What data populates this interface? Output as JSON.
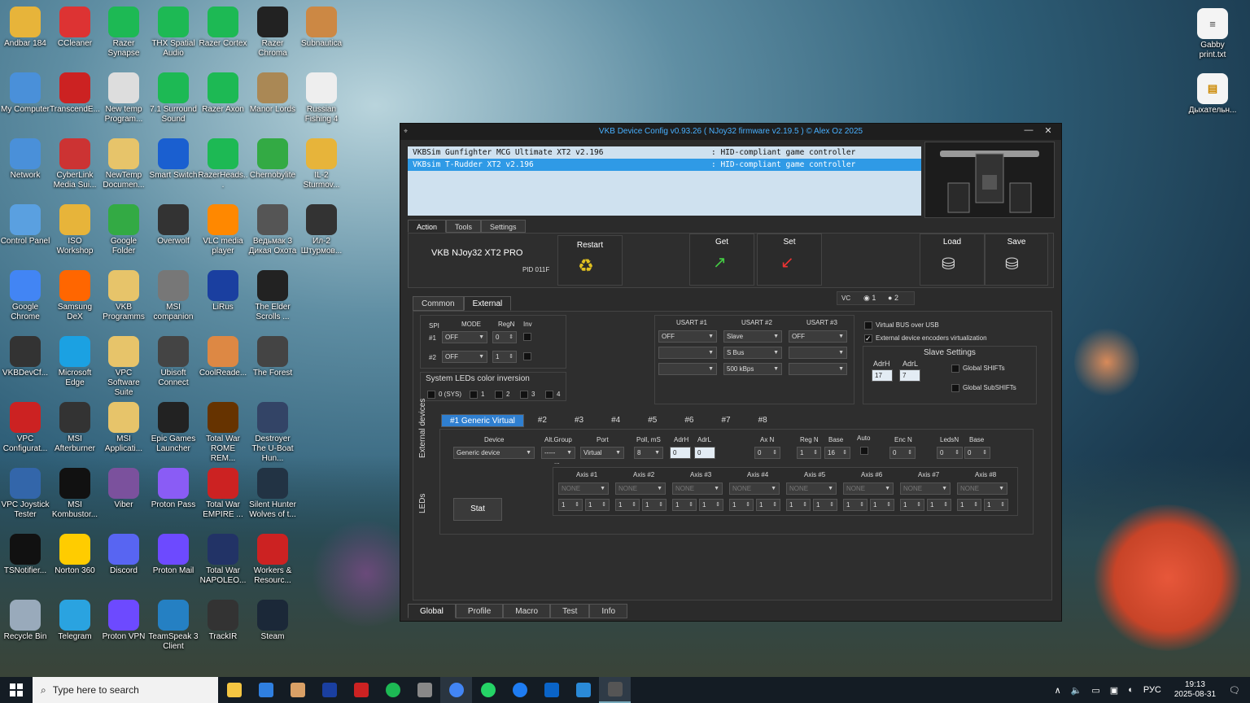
{
  "desktop_icons": [
    {
      "label": "Andbar 184",
      "color": "#e7b43a"
    },
    {
      "label": "CCleaner",
      "color": "#d33"
    },
    {
      "label": "Razer Synapse",
      "color": "#1db954"
    },
    {
      "label": "THX Spatial Audio",
      "color": "#1db954"
    },
    {
      "label": "Razer Cortex",
      "color": "#1db954"
    },
    {
      "label": "Razer Chroma",
      "color": "#222"
    },
    {
      "label": "Subnautica",
      "color": "#c84"
    },
    {
      "label": "My Computer",
      "color": "#4a90d9"
    },
    {
      "label": "TranscendE...",
      "color": "#c22"
    },
    {
      "label": "New temp Program...",
      "color": "#ddd"
    },
    {
      "label": "7.1 Surround Sound",
      "color": "#1db954"
    },
    {
      "label": "Razer Axon",
      "color": "#1db954"
    },
    {
      "label": "Manor Lords",
      "color": "#a85"
    },
    {
      "label": "Russian Fishing 4",
      "color": "#eee"
    },
    {
      "label": "Network",
      "color": "#4a90d9"
    },
    {
      "label": "CyberLink Media Sui...",
      "color": "#c33"
    },
    {
      "label": "NewTemp Documen...",
      "color": "#e7c46a"
    },
    {
      "label": "Smart Switch",
      "color": "#1a5fd0"
    },
    {
      "label": "RazerHeads...",
      "color": "#1db954"
    },
    {
      "label": "Chernobylite",
      "color": "#3a4"
    },
    {
      "label": "IL-2 Sturmov...",
      "color": "#e7b43a"
    },
    {
      "label": "Control Panel",
      "color": "#5aa0e0"
    },
    {
      "label": "ISO Workshop",
      "color": "#e7b43a"
    },
    {
      "label": "Google Folder",
      "color": "#3a4"
    },
    {
      "label": "Overwolf",
      "color": "#333"
    },
    {
      "label": "VLC media player",
      "color": "#f80"
    },
    {
      "label": "Ведьмак 3 Дикая Охота",
      "color": "#555"
    },
    {
      "label": "Ил-2 Штурмов...",
      "color": "#333"
    },
    {
      "label": "Google Chrome",
      "color": "#4285f4"
    },
    {
      "label": "Samsung DeX",
      "color": "#f60"
    },
    {
      "label": "VKB Programms",
      "color": "#e7c46a"
    },
    {
      "label": "MSI companion",
      "color": "#777"
    },
    {
      "label": "LiRus",
      "color": "#1a3fa0"
    },
    {
      "label": "The Elder Scrolls ...",
      "color": "#222"
    },
    {
      "label": "VKBDevCf...",
      "color": "#333"
    },
    {
      "label": "Microsoft Edge",
      "color": "#1ba1e2"
    },
    {
      "label": "VPC Software Suite",
      "color": "#e7c46a"
    },
    {
      "label": "Ubisoft Connect",
      "color": "#444"
    },
    {
      "label": "CoolReade...",
      "color": "#d84"
    },
    {
      "label": "The Forest",
      "color": "#444"
    },
    {
      "label": "VPC Configurat...",
      "color": "#c22"
    },
    {
      "label": "MSI Afterburner",
      "color": "#333"
    },
    {
      "label": "MSI Applicati...",
      "color": "#e7c46a"
    },
    {
      "label": "Epic Games Launcher",
      "color": "#222"
    },
    {
      "label": "Total War ROME REM...",
      "color": "#630"
    },
    {
      "label": "Destroyer The U-Boat Hun...",
      "color": "#346"
    },
    {
      "label": "VPC Joystick Tester",
      "color": "#36a"
    },
    {
      "label": "MSI Kombustor...",
      "color": "#111"
    },
    {
      "label": "Viber",
      "color": "#7b519d"
    },
    {
      "label": "Proton Pass",
      "color": "#8a5cf5"
    },
    {
      "label": "Total War EMPIRE ...",
      "color": "#c22"
    },
    {
      "label": "Silent Hunter Wolves of t...",
      "color": "#234"
    },
    {
      "label": "TSNotifier...",
      "color": "#111"
    },
    {
      "label": "Norton 360",
      "color": "#fc0"
    },
    {
      "label": "Discord",
      "color": "#5865f2"
    },
    {
      "label": "Proton Mail",
      "color": "#6d4aff"
    },
    {
      "label": "Total War NAPOLEO...",
      "color": "#236"
    },
    {
      "label": "Workers & Resourc...",
      "color": "#c22"
    },
    {
      "label": "Recycle Bin",
      "color": "#9ab"
    },
    {
      "label": "Telegram",
      "color": "#2aa3e0"
    },
    {
      "label": "Proton VPN",
      "color": "#6d4aff"
    },
    {
      "label": "TeamSpeak 3 Client",
      "color": "#2580c3"
    },
    {
      "label": "TrackIR",
      "color": "#333"
    },
    {
      "label": "Steam",
      "color": "#1b2838"
    }
  ],
  "right_icons": [
    {
      "label": "Gabby print.txt"
    },
    {
      "label": "Дыхательн..."
    }
  ],
  "taskbar": {
    "search_placeholder": "Type here to search",
    "lang": "РУС",
    "time": "19:13",
    "date": "2025-08-31"
  },
  "window": {
    "title": "VKB Device Config v0.93.26 ( NJoy32 firmware v2.19.5 ) © Alex Oz 2025",
    "devices": [
      {
        "name": "VKBSim Gunfighter MCG Ultimate XT2 v2.196",
        "type": ": HID-compliant game controller"
      },
      {
        "name": "VKBsim T-Rudder XT2 v2.196",
        "type": ": HID-compliant game controller"
      }
    ],
    "top_tabs": [
      "Action",
      "Tools",
      "Settings"
    ],
    "device_name": "VKB NJoy32 XT2 PRO",
    "pid": "PID 011F",
    "buttons": {
      "restart": "Restart",
      "get": "Get",
      "set": "Set",
      "load": "Load",
      "save": "Save"
    },
    "vc": {
      "label": "VC",
      "opt1": "1",
      "opt2": "2"
    },
    "sub_tabs": [
      "Common",
      "External"
    ],
    "spi": {
      "header": "SPI",
      "mode": "MODE",
      "regn": "RegN",
      "inv": "Inv",
      "rows": [
        {
          "id": "#1",
          "mode": "OFF",
          "regn": "0"
        },
        {
          "id": "#2",
          "mode": "OFF",
          "regn": "1"
        }
      ]
    },
    "usart": {
      "headers": [
        "USART #1",
        "USART #2",
        "USART #3"
      ],
      "rows": [
        [
          "OFF",
          "Slave",
          "OFF"
        ],
        [
          "",
          "S Bus",
          ""
        ],
        [
          "",
          "500 kBps",
          ""
        ]
      ]
    },
    "virtual_bus": "Virtual BUS over USB",
    "ext_enc": "External device encoders virtualization",
    "slave": {
      "title": "Slave Settings",
      "adrh_label": "AdrH",
      "adrl_label": "AdrL",
      "adrh": "17",
      "adrl": "7",
      "global_shifts": "Global SHIFTs",
      "global_subshifts": "Global SubSHIFTs"
    },
    "leds_inv": {
      "title": "System LEDs color inversion",
      "items": [
        "0 (SYS)",
        "1",
        "2",
        "3",
        "4"
      ]
    },
    "side_tabs": [
      "External devices",
      "LEDs"
    ],
    "virt_tabs": [
      "#1 Generic Virtual",
      "#2",
      "#3",
      "#4",
      "#5",
      "#6",
      "#7",
      "#8"
    ],
    "ext": {
      "device_label": "Device",
      "device": "Generic device",
      "altgroup_label": "Alt.Group",
      "altgroup": "-----",
      "port_label": "Port",
      "port": "Virtual",
      "poll_label": "Poll, mS",
      "poll": "8",
      "adrh_label": "AdrH",
      "adrh": "0",
      "adrl_label": "AdrL",
      "adrl": "0",
      "axn_label": "Ax N",
      "axn": "0",
      "regn_label": "Reg N",
      "regn": "1",
      "base_label": "Base",
      "base": "16",
      "auto_label": "Auto",
      "encn_label": "Enc N",
      "encn": "0",
      "ledsn_label": "LedsN",
      "ledsn": "0",
      "base2_label": "Base",
      "base2": "0",
      "dots": "...",
      "stat": "Stat"
    },
    "axes": [
      "Axis #1",
      "Axis #2",
      "Axis #3",
      "Axis #4",
      "Axis #5",
      "Axis #6",
      "Axis #7",
      "Axis #8"
    ],
    "axis_value": "NONE",
    "axis_num": "1",
    "bottom_tabs": [
      "Global",
      "Profile",
      "Macro",
      "Test",
      "Info"
    ]
  }
}
